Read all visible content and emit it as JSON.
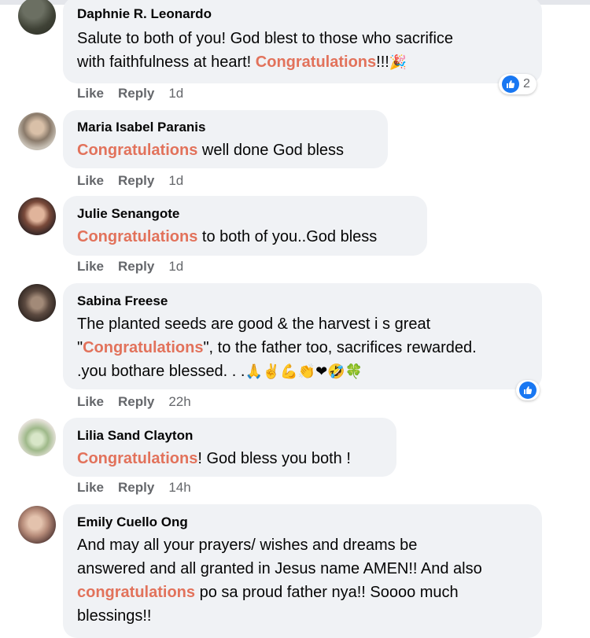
{
  "comments": [
    {
      "name": "Daphnie R. Leonardo",
      "line1": "Salute to both of you! God blest to those who sacrifice",
      "line2_pre": "with faithfulness at heart! ",
      "line2_hl": "Congratulations",
      "line2_post": "!!!",
      "line2_emoji": "🎉",
      "like": "Like",
      "reply": "Reply",
      "time": "1d",
      "reaction_count": "2"
    },
    {
      "name": "Maria Isabel Paranis",
      "hl": "Congratulations",
      "post": " well done God bless",
      "like": "Like",
      "reply": "Reply",
      "time": "1d"
    },
    {
      "name": "Julie Senangote",
      "hl": "Congratulations",
      "post": " to both of you..God bless",
      "like": "Like",
      "reply": "Reply",
      "time": "1d"
    },
    {
      "name": "Sabina Freese",
      "line1": "The planted seeds are good & the harvest i s great",
      "line2_pre": "\"",
      "line2_hl": "Congratulations",
      "line2_post": "\", to the father too, sacrifices rewarded.",
      "line3": ".you bothare blessed. . .",
      "line3_emojis": "🙏✌💪👏❤🤣🍀",
      "like": "Like",
      "reply": "Reply",
      "time": "22h"
    },
    {
      "name": "Lilia Sand Clayton",
      "hl": "Congratulations",
      "post": "! God bless you both !",
      "like": "Like",
      "reply": "Reply",
      "time": "14h"
    },
    {
      "name": "Emily Cuello Ong",
      "line1": "And may all your prayers/ wishes and dreams be",
      "line2": "answered and all granted in Jesus name AMEN!! And also",
      "line3_hl": "congratulations",
      "line3_post": " po sa proud father nya!! Soooo much",
      "line4": "blessings!!"
    }
  ],
  "colors": {
    "bubble": "#f0f2f5",
    "highlight": "#e2725b",
    "meta": "#65676b",
    "like_blue": "#1877f2"
  },
  "icons": {
    "like": "thumbs-up-icon"
  }
}
